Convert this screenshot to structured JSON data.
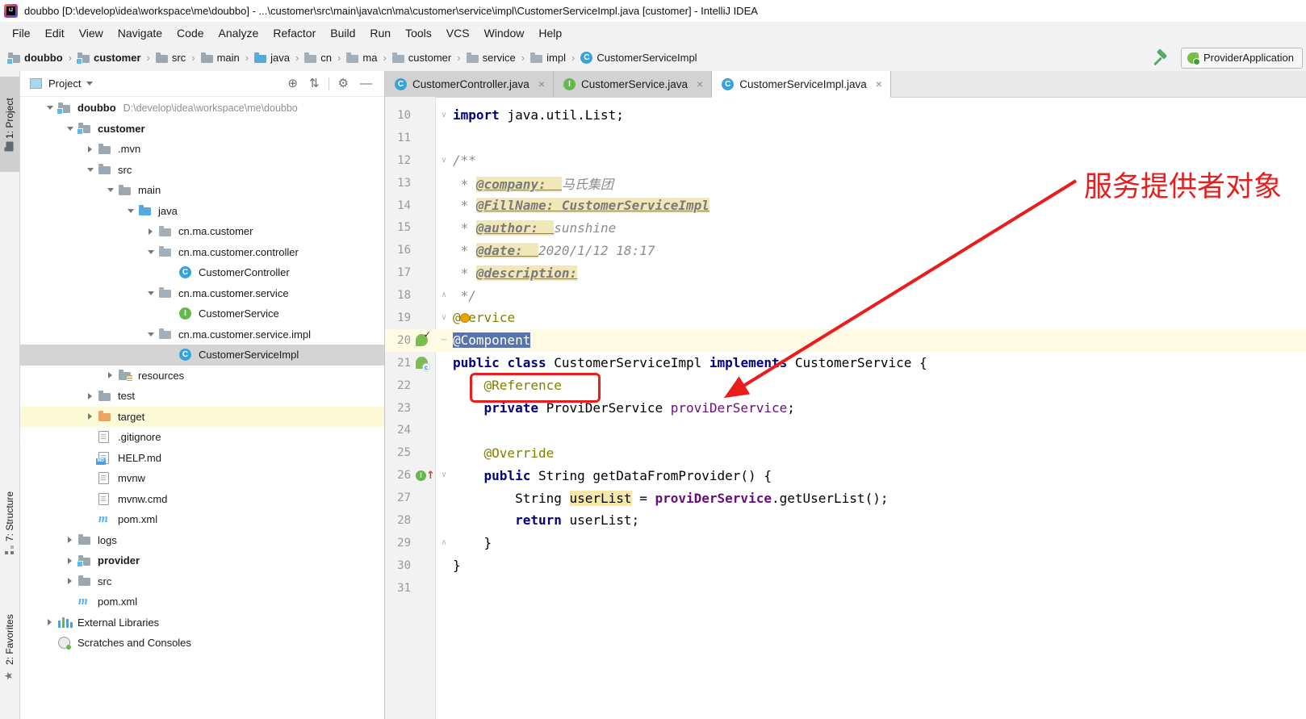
{
  "title_bar": {
    "title": "doubbo [D:\\develop\\idea\\workspace\\me\\doubbo] - ...\\customer\\src\\main\\java\\cn\\ma\\customer\\service\\impl\\CustomerServiceImpl.java [customer] - IntelliJ IDEA"
  },
  "menu": {
    "items": [
      "File",
      "Edit",
      "View",
      "Navigate",
      "Code",
      "Analyze",
      "Refactor",
      "Build",
      "Run",
      "Tools",
      "VCS",
      "Window",
      "Help"
    ]
  },
  "toolbar": {
    "breadcrumbs": [
      {
        "label": "doubbo",
        "icon": "module",
        "bold": true
      },
      {
        "label": "customer",
        "icon": "module",
        "bold": true
      },
      {
        "label": "src",
        "icon": "folder"
      },
      {
        "label": "main",
        "icon": "folder"
      },
      {
        "label": "java",
        "icon": "src-folder"
      },
      {
        "label": "cn",
        "icon": "package"
      },
      {
        "label": "ma",
        "icon": "package"
      },
      {
        "label": "customer",
        "icon": "package"
      },
      {
        "label": "service",
        "icon": "package"
      },
      {
        "label": "impl",
        "icon": "package"
      },
      {
        "label": "CustomerServiceImpl",
        "icon": "class"
      }
    ],
    "run_config": {
      "label": "ProviderApplication",
      "icon": "spring-boot"
    }
  },
  "tool_window_bar": {
    "project": "1: Project",
    "structure": "7: Structure",
    "favorites": "2: Favorites"
  },
  "project_panel": {
    "header": {
      "title": "Project",
      "icons": [
        "locate",
        "collapse-all",
        "settings",
        "hide"
      ]
    },
    "tree": [
      {
        "label": "doubbo",
        "suffix": "D:\\develop\\idea\\workspace\\me\\doubbo",
        "icon": "module",
        "level": 0,
        "chevron": "open",
        "bold": true
      },
      {
        "label": "customer",
        "icon": "module",
        "level": 1,
        "chevron": "open",
        "bold": true
      },
      {
        "label": ".mvn",
        "icon": "folder",
        "level": 2,
        "chevron": "closed"
      },
      {
        "label": "src",
        "icon": "folder",
        "level": 2,
        "chevron": "open"
      },
      {
        "label": "main",
        "icon": "folder",
        "level": 3,
        "chevron": "open"
      },
      {
        "label": "java",
        "icon": "src-folder",
        "level": 4,
        "chevron": "open"
      },
      {
        "label": "cn.ma.customer",
        "icon": "package",
        "level": 5,
        "chevron": "closed"
      },
      {
        "label": "cn.ma.customer.controller",
        "icon": "package",
        "level": 5,
        "chevron": "open"
      },
      {
        "label": "CustomerController",
        "icon": "class",
        "level": 6
      },
      {
        "label": "cn.ma.customer.service",
        "icon": "package",
        "level": 5,
        "chevron": "open"
      },
      {
        "label": "CustomerService",
        "icon": "interface",
        "level": 6
      },
      {
        "label": "cn.ma.customer.service.impl",
        "icon": "package",
        "level": 5,
        "chevron": "open"
      },
      {
        "label": "CustomerServiceImpl",
        "icon": "class",
        "level": 6,
        "selected": true
      },
      {
        "label": "resources",
        "icon": "resources-folder",
        "level": 3,
        "chevron": "closed"
      },
      {
        "label": "test",
        "icon": "folder",
        "level": 2,
        "chevron": "closed"
      },
      {
        "label": "target",
        "icon": "target-folder",
        "level": 2,
        "chevron": "closed",
        "highlight": true
      },
      {
        "label": ".gitignore",
        "icon": "file",
        "level": 2
      },
      {
        "label": "HELP.md",
        "icon": "markdown-file",
        "level": 2
      },
      {
        "label": "mvnw",
        "icon": "file",
        "level": 2
      },
      {
        "label": "mvnw.cmd",
        "icon": "file",
        "level": 2
      },
      {
        "label": "pom.xml",
        "icon": "maven",
        "level": 2
      },
      {
        "label": "logs",
        "icon": "folder",
        "level": 1,
        "chevron": "closed"
      },
      {
        "label": "provider",
        "icon": "module",
        "level": 1,
        "chevron": "closed",
        "bold": true
      },
      {
        "label": "src",
        "icon": "folder",
        "level": 1,
        "chevron": "closed"
      },
      {
        "label": "pom.xml",
        "icon": "maven",
        "level": 1
      },
      {
        "label": "External Libraries",
        "icon": "libraries",
        "level": 0,
        "chevron": "closed"
      },
      {
        "label": "Scratches and Consoles",
        "icon": "scratches",
        "level": 0
      }
    ]
  },
  "editor": {
    "tabs": [
      {
        "label": "CustomerController.java",
        "icon": "class",
        "active": false
      },
      {
        "label": "CustomerService.java",
        "icon": "interface",
        "active": false
      },
      {
        "label": "CustomerServiceImpl.java",
        "icon": "class",
        "active": true
      }
    ],
    "close_glyph": "×",
    "lines": [
      {
        "num": 10,
        "fold": "down",
        "tokens": [
          [
            "import",
            "kw"
          ],
          [
            " java.util.List;",
            "pl"
          ]
        ]
      },
      {
        "num": 11,
        "tokens": []
      },
      {
        "num": 12,
        "fold": "down",
        "tokens": [
          [
            "/**",
            "doc"
          ]
        ]
      },
      {
        "num": 13,
        "tokens": [
          [
            " * ",
            "doc"
          ],
          [
            "@company:  ",
            "doctag"
          ],
          [
            "马氏集团",
            "docv"
          ]
        ]
      },
      {
        "num": 14,
        "tokens": [
          [
            " * ",
            "doc"
          ],
          [
            "@FillName: CustomerServiceImpl",
            "doctag"
          ]
        ]
      },
      {
        "num": 15,
        "tokens": [
          [
            " * ",
            "doc"
          ],
          [
            "@author:  ",
            "doctag"
          ],
          [
            "sunshine",
            "docv"
          ]
        ]
      },
      {
        "num": 16,
        "tokens": [
          [
            " * ",
            "doc"
          ],
          [
            "@date:  ",
            "doctag"
          ],
          [
            "2020/1/12 18:17",
            "docv"
          ]
        ]
      },
      {
        "num": 17,
        "tokens": [
          [
            " * ",
            "doc"
          ],
          [
            "@description:",
            "doctag"
          ]
        ]
      },
      {
        "num": 18,
        "fold": "up",
        "tokens": [
          [
            " */",
            "doc"
          ]
        ]
      },
      {
        "num": 19,
        "fold": "down",
        "tokens": [
          [
            "@",
            "ann"
          ],
          [
            "S",
            "bulb"
          ],
          [
            "ervice",
            "ann"
          ]
        ]
      },
      {
        "num": 20,
        "fold": "minus",
        "bg": true,
        "gutter": "spring-bean",
        "tokens": [
          [
            "@Component",
            "sel"
          ]
        ]
      },
      {
        "num": 21,
        "gutter": "spring-component",
        "tokens": [
          [
            "public",
            "kw"
          ],
          [
            " ",
            "pl"
          ],
          [
            "class",
            "kw"
          ],
          [
            " CustomerServiceImpl ",
            "pl"
          ],
          [
            "implements",
            "kw"
          ],
          [
            " CustomerService {",
            "pl"
          ]
        ]
      },
      {
        "num": 22,
        "tokens": [
          [
            "    ",
            "pl"
          ],
          [
            "@Reference",
            "ann"
          ]
        ]
      },
      {
        "num": 23,
        "tokens": [
          [
            "    ",
            "pl"
          ],
          [
            "private",
            "kw"
          ],
          [
            " ProviDerService ",
            "pl"
          ],
          [
            "proviDerService",
            "fieldd"
          ],
          [
            ";",
            "pl"
          ]
        ]
      },
      {
        "num": 24,
        "tokens": []
      },
      {
        "num": 25,
        "tokens": [
          [
            "    ",
            "pl"
          ],
          [
            "@Override",
            "ann"
          ]
        ]
      },
      {
        "num": 26,
        "fold": "down",
        "gutter": "override",
        "tokens": [
          [
            "    ",
            "pl"
          ],
          [
            "public",
            "kw"
          ],
          [
            " String getDataFromProvider() {",
            "pl"
          ]
        ]
      },
      {
        "num": 27,
        "tokens": [
          [
            "        String ",
            "pl"
          ],
          [
            "userList",
            "hl"
          ],
          [
            " = ",
            "pl"
          ],
          [
            "proviDerService",
            "field"
          ],
          [
            ".getUserList();",
            "pl"
          ]
        ]
      },
      {
        "num": 28,
        "tokens": [
          [
            "        ",
            "pl"
          ],
          [
            "return",
            "kw"
          ],
          [
            " userList;",
            "pl"
          ]
        ]
      },
      {
        "num": 29,
        "fold": "up",
        "tokens": [
          [
            "    }",
            "pl"
          ]
        ]
      },
      {
        "num": 30,
        "tokens": [
          [
            "}",
            "pl"
          ]
        ]
      },
      {
        "num": 31,
        "tokens": []
      }
    ]
  },
  "annotation": {
    "label": "服务提供者对象",
    "color": "#ea1c1c"
  },
  "colors": {
    "accent_red": "#ea1c1c",
    "selection_blue": "#5974ab",
    "current_line": "#fffae3",
    "doc_highlight": "#f1e7b8",
    "usage_highlight": "#f7e8a9"
  }
}
